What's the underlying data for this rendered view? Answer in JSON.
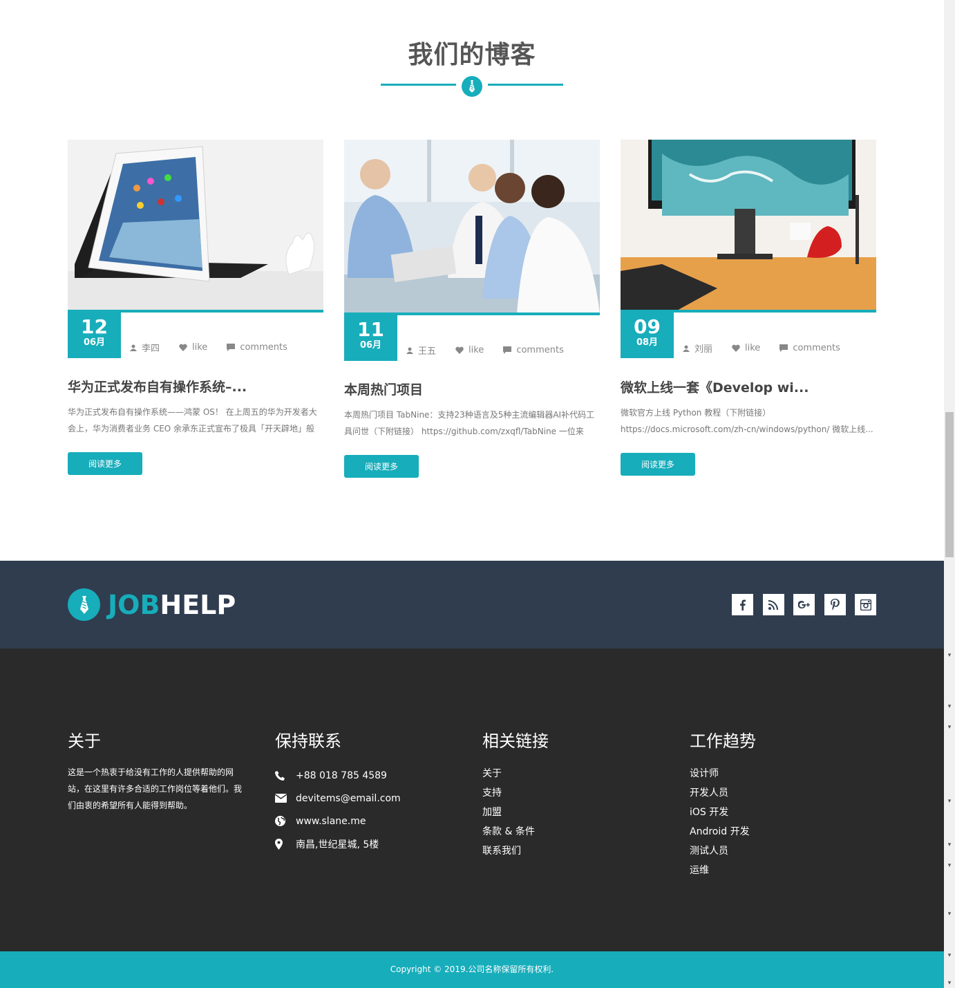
{
  "blog": {
    "title": "我们的博客",
    "posts": [
      {
        "day": "12",
        "month": "06月",
        "author": "李四",
        "like": "like",
        "comments": "comments",
        "title": "华为正式发布自有操作系统–...",
        "excerpt": "华为正式发布自有操作系统——鸿蒙 OS！ 在上周五的华为开发者大会上，华为消费者业务 CEO 余承东正式宣布了极具「开天辟地」般意...",
        "button": "阅读更多",
        "image": "tablet-photo"
      },
      {
        "day": "11",
        "month": "06月",
        "author": "王五",
        "like": "like",
        "comments": "comments",
        "title": "本周热门项目",
        "excerpt": "本周热门项目   TabNine：支持23种语言及5种主流编辑器AI补代码工具问世（下附链接） https://github.com/zxqfl/TabNine 一位来自...",
        "button": "阅读更多",
        "image": "business-meeting-photo"
      },
      {
        "day": "09",
        "month": "08月",
        "author": "刘丽",
        "like": "like",
        "comments": "comments",
        "title": "微软上线一套《Develop wi...",
        "excerpt": "微软官方上线 Python 教程（下附链接） https://docs.microsoft.com/zh-cn/windows/python/ 微软上线...",
        "button": "阅读更多",
        "image": "monitor-desk-photo"
      }
    ]
  },
  "brand": {
    "logo_part1": "JOB",
    "logo_part2": "HELP",
    "accent_color": "#17adbb",
    "dark_color": "#2f3d4f"
  },
  "socials": [
    "facebook-icon",
    "rss-icon",
    "google-plus-icon",
    "pinterest-icon",
    "instagram-icon"
  ],
  "footer": {
    "about": {
      "heading": "关于",
      "text": "这是一个热衷于给没有工作的人提供帮助的网站，在这里有许多合适的工作岗位等着他们。我们由衷的希望所有人能得到帮助。"
    },
    "contact": {
      "heading": "保持联系",
      "phone": "+88 018 785 4589",
      "email": "devitems@email.com",
      "website": "www.slane.me",
      "address": "南昌,世纪星城, 5楼"
    },
    "links": {
      "heading": "相关链接",
      "items": [
        "关于",
        "支持",
        "加盟",
        "条款 & 条件",
        "联系我们"
      ]
    },
    "trends": {
      "heading": "工作趋势",
      "items": [
        "设计师",
        "开发人员",
        "iOS 开发",
        "Android 开发",
        "测试人员",
        "运维"
      ]
    },
    "copyright": "Copyright © 2019.公司名称保留所有权利."
  }
}
